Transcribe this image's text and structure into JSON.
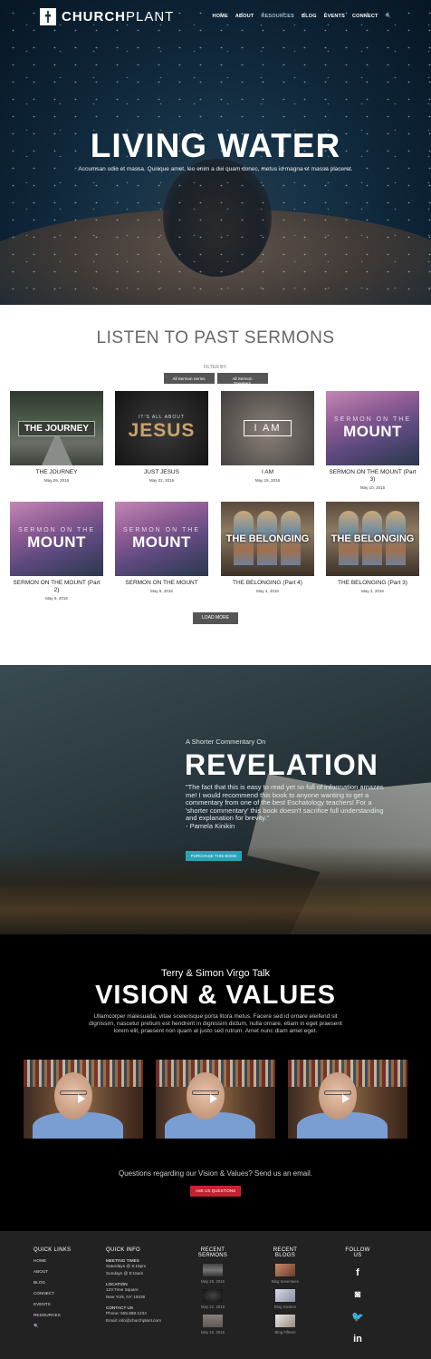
{
  "nav": {
    "logo_bold": "CHURCH",
    "logo_light": "PLANT",
    "items": [
      "HOME",
      "ABOUT",
      "RESOURCES",
      "BLOG",
      "EVENTS",
      "CONNECT"
    ],
    "active": "RESOURCES",
    "search_icon": "🔍"
  },
  "hero": {
    "title": "LIVING WATER",
    "subtitle": "Accumsan odio et massa. Quisque amet, leo enim a dui quam donec, metus id magna et massa placerat."
  },
  "sermons": {
    "title": "LISTEN TO PAST SERMONS",
    "filter_label": "FILTER BY:",
    "filter_series": "All Sermon Series",
    "filter_speakers": "All Sermon Speakers",
    "items": [
      {
        "title": "THE JOURNEY",
        "date": "May 29, 2016",
        "thumb": "THE JOURNEY"
      },
      {
        "title": "JUST JESUS",
        "date": "May 22, 2016",
        "thumb_small": "IT'S ALL ABOUT",
        "thumb": "JESUS"
      },
      {
        "title": "I AM",
        "date": "May 15, 2016",
        "thumb": "I AM"
      },
      {
        "title": "SERMON ON THE MOUNT (Part 3)",
        "date": "May 10, 2016",
        "thumb_small": "SERMON ON THE",
        "thumb": "MOUNT"
      },
      {
        "title": "SERMON ON THE MOUNT (Part 2)",
        "date": "May 9, 2016",
        "thumb_small": "SERMON ON THE",
        "thumb": "MOUNT"
      },
      {
        "title": "SERMON ON THE MOUNT",
        "date": "May 8, 2016",
        "thumb_small": "SERMON ON THE",
        "thumb": "MOUNT"
      },
      {
        "title": "THE BELONGING (Part 4)",
        "date": "May 4, 2016",
        "thumb": "THE BELONGING"
      },
      {
        "title": "THE BELONGING (Part 3)",
        "date": "May 3, 2016",
        "thumb": "THE BELONGING"
      }
    ],
    "load_more": "LOAD MORE"
  },
  "revelation": {
    "kicker": "A Shorter Commentary On",
    "title": "REVELATION",
    "quote": "\"The fact that this is easy to read yet so full of information amazes me! I would recommend this book to anyone wanting to get a commentary from one of the best Eschatology teachers! For a 'shorter commentary' this book doesn't sacrifice full understanding and explanation for brevity.\"",
    "author": "- Pamela Kinikin",
    "button": "PURCHASE THIS BOOK"
  },
  "vision": {
    "kicker": "Terry & Simon Virgo Talk",
    "title": "VISION & VALUES",
    "text": "Ullamcorper malesuada, vitae scelerisque porta litora metus. Facere sed id ornare eleifend sit dignissim, nascetur pretium est hendrerit in dignissim dictum, nulla ornare, etiam in eget praesent lorem elit, praesent non quam at justo sed rutrum. Amet nunc diam amet eget.",
    "question": "Questions regarding our Vision & Values?  Send us an email.",
    "button": "ASK US QUESTIONS"
  },
  "footer": {
    "quick_links": {
      "heading": "QUICK LINKS",
      "items": [
        "HOME",
        "ABOUT",
        "BLOG",
        "CONNECT",
        "EVENTS",
        "RESOURCES"
      ]
    },
    "quick_info": {
      "heading": "QUICK INFO",
      "meeting_label": "MEETING TIMES",
      "meeting_1": "Saturdays @ 6:15pm",
      "meeting_2": "Sundays @ 9:15am",
      "location_label": "LOCATION",
      "address_1": "123 Time Square",
      "address_2": "New York, NY 10036",
      "contact_label": "CONTACT US",
      "phone": "Phone: 555.888.1234",
      "email": "Email: info@churchplant.com"
    },
    "recent_sermons": {
      "heading": "RECENT SERMONS",
      "items": [
        "May 29, 2016",
        "May 22, 2016",
        "May 15, 2016"
      ]
    },
    "recent_blogs": {
      "heading": "RECENT BLOGS",
      "items": [
        "Blog Seventeen",
        "Blog Sixteen",
        "Blog Fifteen"
      ]
    },
    "follow": {
      "heading": "FOLLOW US",
      "icons": [
        "f",
        "◙",
        "🐦",
        "in"
      ]
    }
  }
}
